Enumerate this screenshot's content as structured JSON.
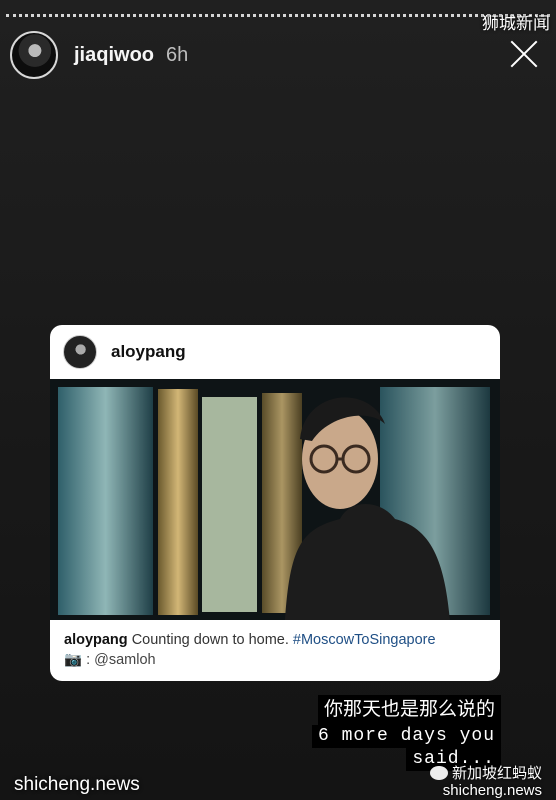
{
  "overlay": {
    "top_watermark": "狮城新闻"
  },
  "story": {
    "username": "jiaqiwoo",
    "time_ago": "6h",
    "close_icon": "close-icon"
  },
  "shared_post": {
    "username": "aloypang",
    "caption_user": "aloypang",
    "caption_text": "Counting down to home.",
    "hashtag": "#MoscowToSingapore",
    "credit_icon": "camera-icon",
    "credit_text": " : @samloh"
  },
  "sticker": {
    "line_cn": "你那天也是那么说的",
    "line1": "6 more days you",
    "line2": "said..."
  },
  "watermarks": {
    "left": "shicheng.news",
    "right_brand": "新加坡红蚂蚁",
    "right_site": "shicheng.news"
  }
}
